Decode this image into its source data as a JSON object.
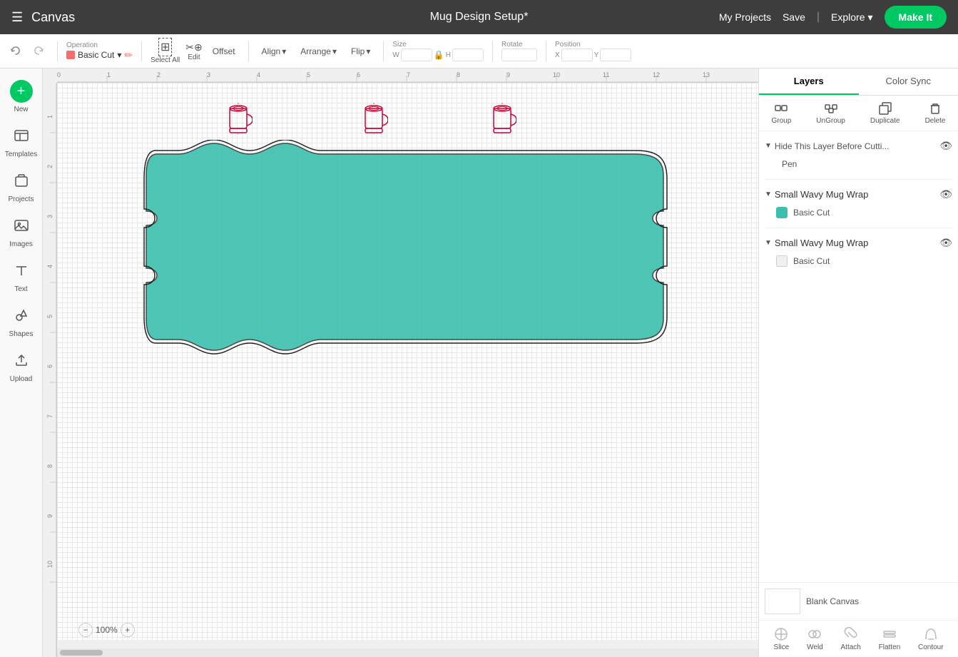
{
  "topnav": {
    "menu_icon": "☰",
    "logo": "Canvas",
    "title": "Mug Design Setup*",
    "my_projects": "My Projects",
    "save": "Save",
    "divider": "|",
    "explore": "Explore",
    "make_it": "Make It"
  },
  "toolbar": {
    "operation_label": "Operation",
    "operation_value": "Basic Cut",
    "select_all_label": "Select All",
    "edit_label": "Edit",
    "offset_label": "Offset",
    "align_label": "Align",
    "arrange_label": "Arrange",
    "flip_label": "Flip",
    "size_label": "Size",
    "w_label": "W",
    "h_label": "H",
    "rotate_label": "Rotate",
    "position_label": "Position",
    "x_label": "X",
    "y_label": "Y"
  },
  "sidebar": {
    "new_label": "New",
    "templates_label": "Templates",
    "projects_label": "Projects",
    "images_label": "Images",
    "text_label": "Text",
    "shapes_label": "Shapes",
    "upload_label": "Upload"
  },
  "layers_panel": {
    "layers_tab": "Layers",
    "color_sync_tab": "Color Sync",
    "group_btn": "Group",
    "ungroup_btn": "UnGroup",
    "duplicate_btn": "Duplicate",
    "delete_btn": "Delete",
    "hide_layer_title": "Hide This Layer Before Cutti...",
    "pen_label": "Pen",
    "layer1_title": "Small Wavy Mug Wrap",
    "layer1_item": "Basic Cut",
    "layer1_color": "#3dbfaf",
    "layer2_title": "Small Wavy Mug Wrap",
    "layer2_item": "Basic Cut",
    "layer2_color": "#f0f0f0",
    "blank_canvas_label": "Blank Canvas"
  },
  "footer_btns": {
    "slice": "Slice",
    "weld": "Weld",
    "attach": "Attach",
    "flatten": "Flatten",
    "contour": "Contour"
  },
  "canvas": {
    "zoom": "100%"
  }
}
